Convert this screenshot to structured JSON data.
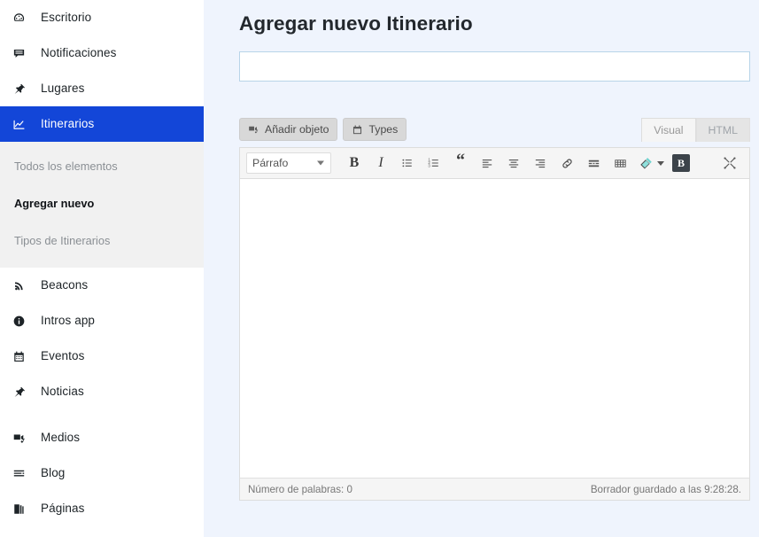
{
  "colors": {
    "accent": "#1346d8",
    "page_bg": "#eff4fd",
    "sidebar_bg": "#ffffff",
    "submenu_bg": "#f1f1f1",
    "toolbar_bg": "#f5f5f5",
    "title_input_border": "#b8d4e8"
  },
  "sidebar": {
    "items": [
      {
        "label": "Escritorio",
        "icon": "dashboard-gauge-icon",
        "active": false
      },
      {
        "label": "Notificaciones",
        "icon": "comment-bubble-icon",
        "active": false
      },
      {
        "label": "Lugares",
        "icon": "pushpin-icon",
        "active": false
      },
      {
        "label": "Itinerarios",
        "icon": "chart-line-icon",
        "active": true
      }
    ],
    "submenu": {
      "parent": "Itinerarios",
      "items": [
        {
          "label": "Todos los elementos",
          "current": false
        },
        {
          "label": "Agregar nuevo",
          "current": true
        },
        {
          "label": "Tipos de Itinerarios",
          "current": false
        }
      ]
    },
    "items_lower": [
      {
        "label": "Beacons",
        "icon": "rss-signal-icon"
      },
      {
        "label": "Intros app",
        "icon": "info-circle-icon"
      },
      {
        "label": "Eventos",
        "icon": "calendar-icon"
      },
      {
        "label": "Noticias",
        "icon": "pushpin-icon"
      }
    ],
    "items_core": [
      {
        "label": "Medios",
        "icon": "media-camera-icon"
      },
      {
        "label": "Blog",
        "icon": "post-lines-icon"
      },
      {
        "label": "Páginas",
        "icon": "pages-stack-icon"
      }
    ]
  },
  "main": {
    "page_title": "Agregar nuevo Itinerario",
    "title_input": {
      "value": "",
      "placeholder": ""
    },
    "media_buttons": [
      {
        "label": "Añadir objeto",
        "icon": "add-media-icon"
      },
      {
        "label": "Types",
        "icon": "types-calendar-icon"
      }
    ],
    "editor_tabs": [
      {
        "label": "Visual",
        "active": true
      },
      {
        "label": "HTML",
        "active": false
      }
    ],
    "toolbar": {
      "format_select": {
        "value": "Párrafo"
      },
      "buttons": [
        {
          "name": "bold-button",
          "glyph": "B"
        },
        {
          "name": "italic-button",
          "glyph": "I"
        },
        {
          "name": "bullet-list-button",
          "glyph": ""
        },
        {
          "name": "numbered-list-button",
          "glyph": ""
        },
        {
          "name": "blockquote-button",
          "glyph": "“"
        },
        {
          "name": "align-left-button",
          "glyph": ""
        },
        {
          "name": "align-center-button",
          "glyph": ""
        },
        {
          "name": "align-right-button",
          "glyph": ""
        },
        {
          "name": "insert-link-button",
          "glyph": ""
        },
        {
          "name": "read-more-button",
          "glyph": ""
        },
        {
          "name": "insert-table-button",
          "glyph": ""
        },
        {
          "name": "toolbar-toggle-button",
          "glyph": ""
        },
        {
          "name": "block-format-button",
          "glyph": "B"
        },
        {
          "name": "fullscreen-button",
          "glyph": ""
        }
      ]
    },
    "editor_content": "",
    "status": {
      "word_count": "Número de palabras: 0",
      "draft_saved": "Borrador guardado a las 9:28:28."
    }
  }
}
